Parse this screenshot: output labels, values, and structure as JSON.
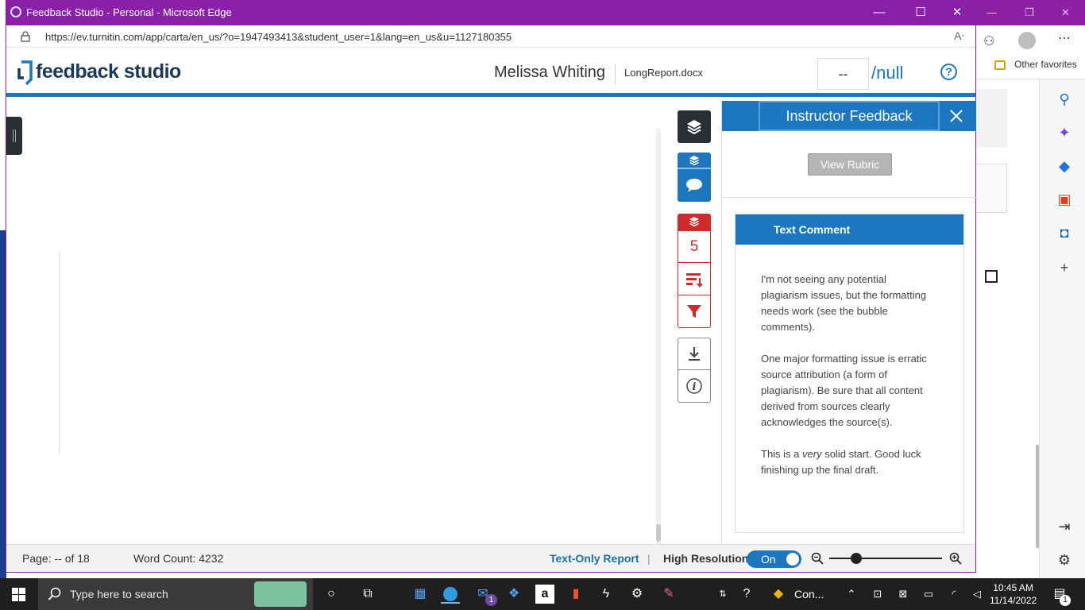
{
  "browser": {
    "window_title": "Feedback Studio - Personal - Microsoft Edge",
    "url": "https://ev.turnitin.com/app/carta/en_us/?o=1947493413&student_user=1&lang=en_us&u=1127180355",
    "read_aloud": "Aͅ",
    "minimize": "—",
    "maximize": "☐",
    "close": "✕",
    "favorites_label": "Other favorites"
  },
  "header": {
    "logo_text": "feedback studio",
    "student_name": "Melissa Whiting",
    "file_name": "LongReport.docx",
    "score": "--",
    "score_total": "/null",
    "help": "?"
  },
  "toolbar": {
    "similarity_count": "5",
    "info": "i"
  },
  "panel": {
    "title": "Instructor Feedback",
    "view_rubric": "View Rubric",
    "comment_title": "Text Comment",
    "comment_p1": "I'm not seeing any potential plagiarism issues, but the formatting needs work (see the bubble comments).",
    "comment_p2": "One major formatting issue is erratic source attribution (a form of plagiarism). Be sure that all content derived from sources clearly acknowledges the source(s).",
    "comment_p3_pre": "This is a ",
    "comment_p3_em": "very",
    "comment_p3_post": " solid start. Good luck finishing up the final draft."
  },
  "status": {
    "page": "Page: -- of 18",
    "word_count": "Word Count: 4232",
    "text_only": "Text-Only Report",
    "separator": "|",
    "high_res": "High Resolution",
    "toggle": "On"
  },
  "taskbar": {
    "search_placeholder": "Type here to search",
    "mail_badge": "1",
    "app_label": "Con...",
    "time": "10:45 AM",
    "date": "11/14/2022",
    "notif_badge": "1"
  },
  "colors": {
    "accent": "#1c77c0",
    "similarity": "#d02b2b",
    "titlebar": "#8a1fa8",
    "dark": "#2a2e35"
  }
}
